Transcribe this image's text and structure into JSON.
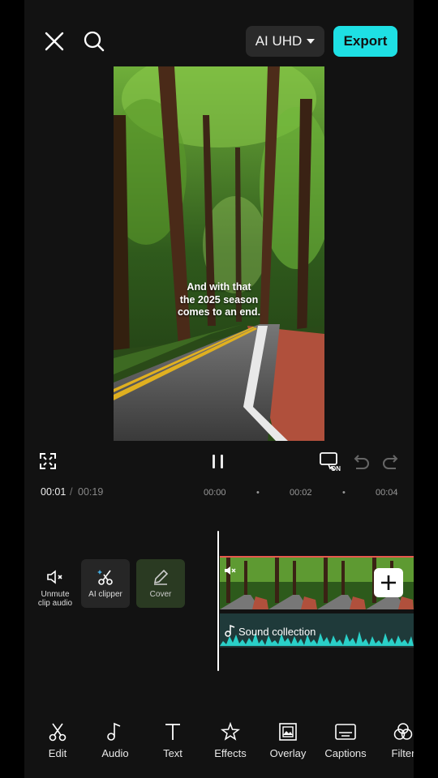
{
  "header": {
    "quality_label": "AI UHD",
    "export_label": "Export"
  },
  "preview": {
    "caption_lines": [
      "And with that",
      "the 2025 season",
      "comes to an end."
    ]
  },
  "playback": {
    "current_time": "00:01",
    "separator": "/",
    "total_time": "00:19",
    "ruler_ticks": [
      "00:00",
      "00:02",
      "00:04"
    ],
    "ruler_dot": "•",
    "toggle_state": "ON"
  },
  "timeline": {
    "tools": [
      {
        "label_line1": "Unmute",
        "label_line2": "clip audio"
      },
      {
        "label": "AI clipper"
      },
      {
        "label": "Cover"
      }
    ],
    "audio_track_label": "Sound collection"
  },
  "toolbar": {
    "items": [
      {
        "label": "Edit",
        "icon": "scissors-icon"
      },
      {
        "label": "Audio",
        "icon": "music-note-icon"
      },
      {
        "label": "Text",
        "icon": "text-icon"
      },
      {
        "label": "Effects",
        "icon": "star-sparkle-icon"
      },
      {
        "label": "Overlay",
        "icon": "overlay-icon"
      },
      {
        "label": "Captions",
        "icon": "captions-icon"
      },
      {
        "label": "Filter",
        "icon": "filter-icon"
      }
    ]
  },
  "colors": {
    "accent": "#1ee0e4",
    "clip_border": "#e65a4d",
    "background": "#121212"
  }
}
